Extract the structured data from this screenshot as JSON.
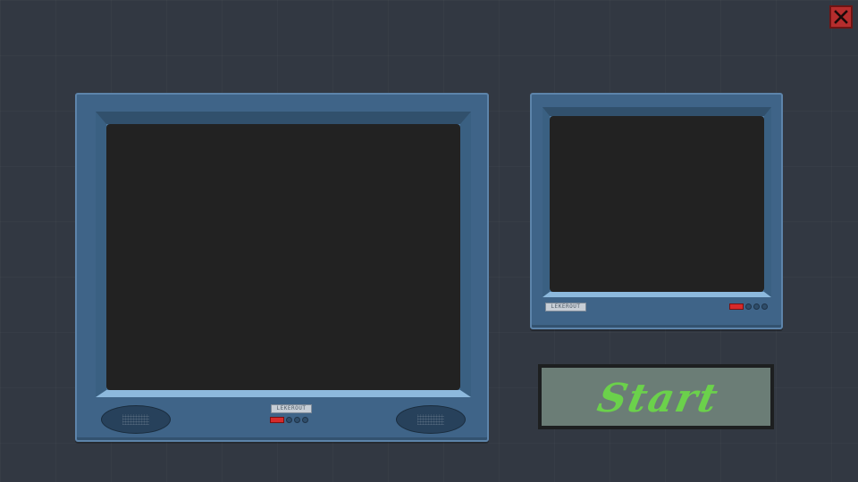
{
  "window": {
    "close_icon": "close-icon"
  },
  "monitors": {
    "large": {
      "brand": "LEKEROUT"
    },
    "small": {
      "brand": "LEKEROUT"
    }
  },
  "start_button": {
    "label": "Start",
    "text_color": "#6bd14b"
  },
  "colors": {
    "background": "#323842",
    "monitor_body": "#3f6488",
    "screen": "#222222",
    "power_led": "#d62a2a",
    "close_button": "#b52d2d"
  }
}
